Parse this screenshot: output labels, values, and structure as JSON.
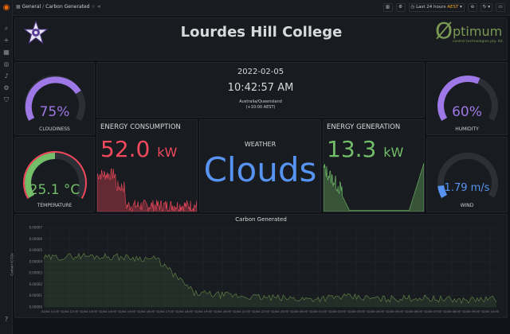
{
  "breadcrumb": {
    "folder": "General",
    "separator": "/",
    "dashboard": "Carbon Generated"
  },
  "toolbar": {
    "time_range": "Last 24 hours",
    "timezone": "AEST"
  },
  "header": {
    "title": "Lourdes Hill College",
    "logo_brand": "ptimum",
    "logo_brand_initial": "Ø",
    "logo_tagline": "control technologies pty. ltd."
  },
  "datetime": {
    "date": "2022-02-05",
    "time": "10:42:57 AM",
    "timezone": "Australia/Queensland",
    "offset": "(+10:00 AEST)"
  },
  "cloudiness": {
    "value": "75%",
    "label": "CLOUDINESS",
    "fraction": 0.75,
    "color": "#9e78e6"
  },
  "temperature": {
    "value": "25.1 °C",
    "label": "TEMPERATURE",
    "fraction": 0.5,
    "color": "#73bf69"
  },
  "humidity": {
    "value": "60%",
    "label": "HUMIDITY",
    "fraction": 0.6,
    "color": "#9e78e6"
  },
  "wind": {
    "value": "1.79 m/s",
    "label": "WIND",
    "fraction": 0.1,
    "color": "#5794f2"
  },
  "consumption": {
    "title": "ENERGY CONSUMPTION",
    "value": "52.0",
    "unit": "kW",
    "color": "#f2495c"
  },
  "generation": {
    "title": "ENERGY GENERATION",
    "value": "13.3",
    "unit": "kW",
    "color": "#73bf69"
  },
  "weather": {
    "title": "WEATHER",
    "value": "Clouds",
    "color": "#5794f2"
  },
  "carbon_chart": {
    "title": "Carbon Generated",
    "ylabel": "Carbon tCO2e",
    "yticks": [
      "0.00000",
      "0.00001",
      "0.00002",
      "0.00003",
      "0.00004",
      "0.00005",
      "0.00006",
      "0.00007"
    ],
    "xticks": [
      "02/04 11:00",
      "02/04 12:00",
      "02/04 13:00",
      "02/04 14:00",
      "02/04 15:00",
      "02/04 16:00",
      "02/04 17:00",
      "02/04 18:00",
      "02/04 19:00",
      "02/04 20:00",
      "02/04 21:00",
      "02/04 22:00",
      "02/04 23:00",
      "02/05 00:00",
      "02/05 01:00",
      "02/05 02:00",
      "02/05 03:00",
      "02/05 04:00",
      "02/05 05:00",
      "02/05 06:00",
      "02/05 07:00",
      "02/05 08:00",
      "02/05 09:00",
      "02/05 10:00"
    ]
  },
  "chart_data": {
    "type": "area",
    "title": "Carbon Generated",
    "ylabel": "Carbon tCO2e",
    "ylim": [
      0,
      7e-05
    ],
    "x": [
      "02/04 11:00",
      "02/04 13:00",
      "02/04 15:00",
      "02/04 17:00",
      "02/04 19:00",
      "02/04 21:00",
      "02/04 23:00",
      "02/05 01:00",
      "02/05 03:00",
      "02/05 05:00",
      "02/05 07:00",
      "02/05 09:00",
      "02/05 10:30"
    ],
    "series": [
      {
        "values": [
          4.3e-05,
          4.5e-05,
          4.4e-05,
          4.2e-05,
          1.2e-05,
          1e-05,
          8e-06,
          7e-06,
          9e-06,
          7e-06,
          8e-06,
          6e-06,
          7e-06
        ]
      }
    ]
  }
}
